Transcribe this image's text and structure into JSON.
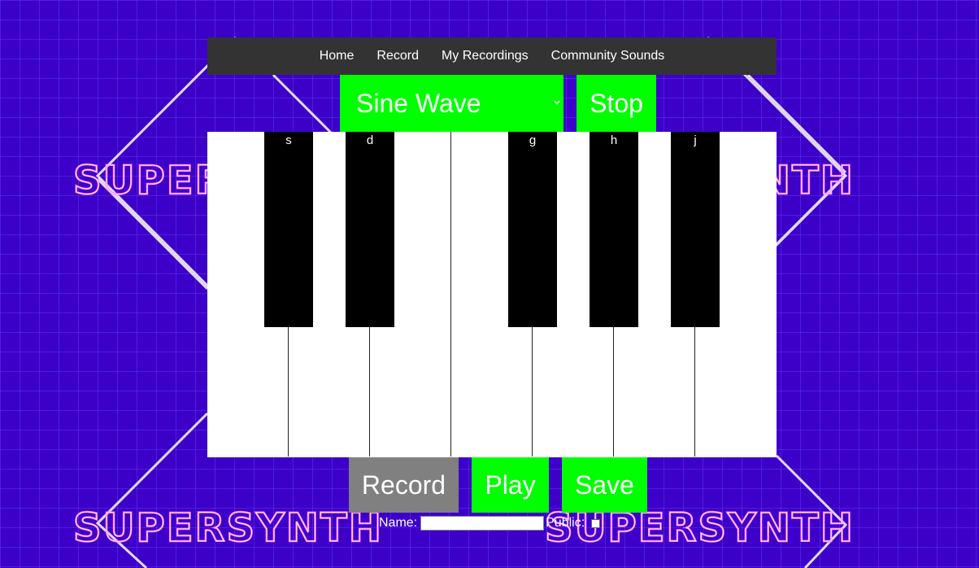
{
  "background": {
    "logo_text": "SUPERSYNTH",
    "colors": {
      "bg": "#3c00c9",
      "logo_stroke": "#ff6bff"
    }
  },
  "nav": {
    "items": [
      {
        "label": "Home"
      },
      {
        "label": "Record"
      },
      {
        "label": "My Recordings"
      },
      {
        "label": "Community Sounds"
      }
    ]
  },
  "synth": {
    "wave_select": {
      "value": "Sine Wave"
    },
    "stop_label": "Stop",
    "accent": "#00ff00"
  },
  "piano": {
    "black_keys": [
      "s",
      "d",
      "g",
      "h",
      "j"
    ],
    "white_key_count": 7
  },
  "controls": {
    "record_label": "Record",
    "play_label": "Play",
    "save_label": "Save",
    "name_label": "Name:",
    "name_value": "",
    "public_label": "Public:",
    "public_checked": false
  }
}
